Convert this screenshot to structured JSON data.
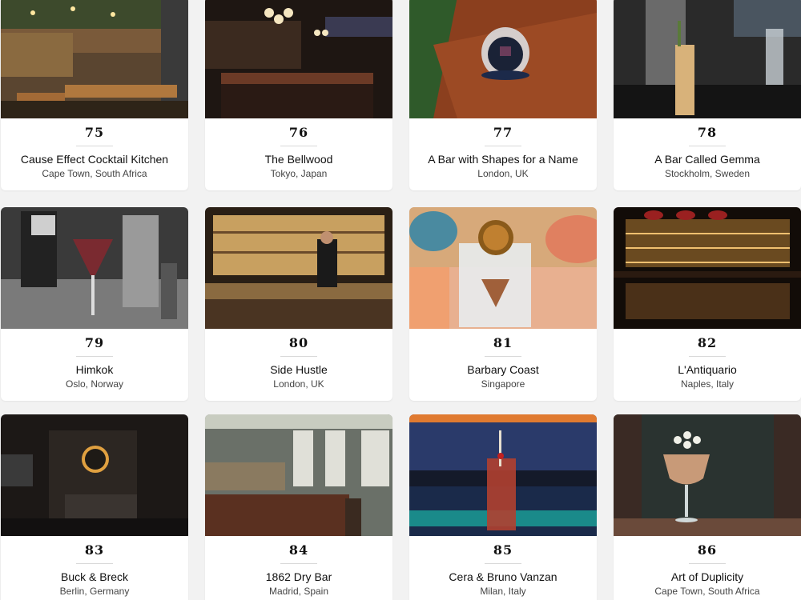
{
  "bars": [
    {
      "rank": "75",
      "name": "Cause Effect Cocktail Kitchen",
      "location": "Cape Town, South Africa",
      "image": "bar-interior-wood-photo"
    },
    {
      "rank": "76",
      "name": "The Bellwood",
      "location": "Tokyo, Japan",
      "image": "dark-bar-counter-photo"
    },
    {
      "rank": "77",
      "name": "A Bar with Shapes for a Name",
      "location": "London, UK",
      "image": "cocktail-on-table-photo"
    },
    {
      "rank": "78",
      "name": "A Bar Called Gemma",
      "location": "Stockholm, Sweden",
      "image": "tall-cocktail-photo"
    },
    {
      "rank": "79",
      "name": "Himkok",
      "location": "Oslo, Norway",
      "image": "bar-tools-cocktail-photo"
    },
    {
      "rank": "80",
      "name": "Side Hustle",
      "location": "London, UK",
      "image": "bartender-back-bar-photo"
    },
    {
      "rank": "81",
      "name": "Barbary Coast",
      "location": "Singapore",
      "image": "citrus-cocktail-photo"
    },
    {
      "rank": "82",
      "name": "L'Antiquario",
      "location": "Naples, Italy",
      "image": "lit-bottle-shelves-photo"
    },
    {
      "rank": "83",
      "name": "Buck & Breck",
      "location": "Berlin, Germany",
      "image": "dark-lounge-photo"
    },
    {
      "rank": "84",
      "name": "1862 Dry Bar",
      "location": "Madrid, Spain",
      "image": "classic-bar-room-photo"
    },
    {
      "rank": "85",
      "name": "Cera & Bruno Vanzan",
      "location": "Milan, Italy",
      "image": "red-highball-photo"
    },
    {
      "rank": "86",
      "name": "Art of Duplicity",
      "location": "Cape Town, South Africa",
      "image": "coupe-cocktail-photo"
    }
  ],
  "colors": {
    "page_background": "#f2f2f2",
    "card_background": "#ffffff",
    "text": "#111111",
    "subtext": "#444444"
  }
}
